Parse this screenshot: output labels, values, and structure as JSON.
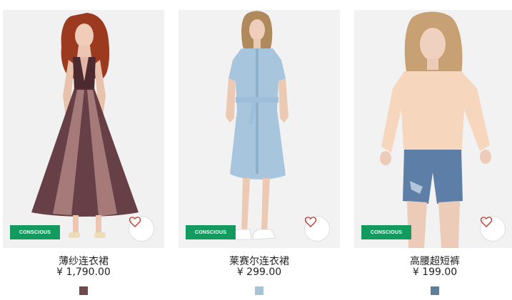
{
  "products": [
    {
      "name": "薄纱连衣裙",
      "price": "¥ 1,790.00",
      "badge": "CONSCIOUS",
      "swatch_color": "#6e4a4c",
      "photo_bg": "#f2f1f2"
    },
    {
      "name": "莱赛尔连衣裙",
      "price": "¥ 299.00",
      "badge": "CONSCIOUS",
      "swatch_color": "#a9c4d6",
      "photo_bg": "#f2f2f3"
    },
    {
      "name": "高腰超短裤",
      "price": "¥ 199.00",
      "badge": "CONSCIOUS",
      "swatch_color": "#5f7d95",
      "photo_bg": "#f3f2f2"
    }
  ],
  "theme": {
    "badge_color": "#139b5f",
    "heart_color": "#c0392b"
  },
  "icons": {
    "favorite": "heart-outline-icon"
  }
}
